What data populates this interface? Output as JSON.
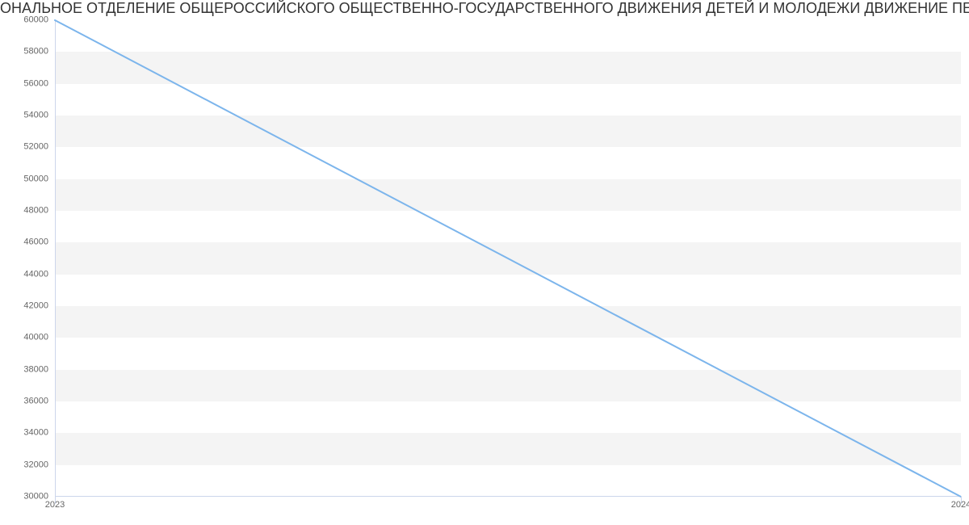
{
  "chart_data": {
    "type": "line",
    "title": "ОНАЛЬНОЕ ОТДЕЛЕНИЕ ОБЩЕРОССИЙСКОГО ОБЩЕСТВЕННО-ГОСУДАРСТВЕННОГО ДВИЖЕНИЯ ДЕТЕЙ И МОЛОДЕЖИ ДВИЖЕНИЕ ПЕРВЫХ СВЕРДЛОВСКОЙ ОБЛАСТИ | Да",
    "x": [
      "2023",
      "2024"
    ],
    "values": [
      60000,
      30000
    ],
    "ylim": [
      30000,
      60000
    ],
    "y_ticks": [
      30000,
      32000,
      34000,
      36000,
      38000,
      40000,
      42000,
      44000,
      46000,
      48000,
      50000,
      52000,
      54000,
      56000,
      58000,
      60000
    ],
    "x_ticks": [
      "2023",
      "2024"
    ],
    "xlabel": "",
    "ylabel": "",
    "line_color": "#7cb5ec"
  }
}
